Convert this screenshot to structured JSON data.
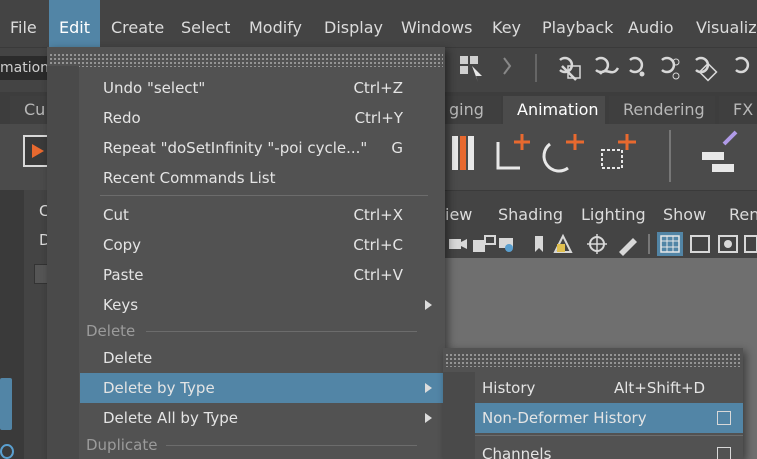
{
  "menubar": {
    "items": [
      {
        "label": "File",
        "active": false
      },
      {
        "label": "Edit",
        "active": true
      },
      {
        "label": "Create",
        "active": false
      },
      {
        "label": "Select",
        "active": false
      },
      {
        "label": "Modify",
        "active": false
      },
      {
        "label": "Display",
        "active": false
      },
      {
        "label": "Windows",
        "active": false
      },
      {
        "label": "Key",
        "active": false
      },
      {
        "label": "Playback",
        "active": false
      },
      {
        "label": "Audio",
        "active": false
      },
      {
        "label": "Visualize",
        "active": false
      }
    ]
  },
  "toolbar": {
    "mode_field": "mation"
  },
  "shelf": {
    "tabs": [
      {
        "label": "Cu",
        "active": false
      },
      {
        "label": "ging",
        "active": false
      },
      {
        "label": "Animation",
        "active": true
      },
      {
        "label": "Rendering",
        "active": false
      },
      {
        "label": "FX",
        "active": false
      }
    ]
  },
  "left_panel": {
    "labels": [
      "C",
      "D"
    ]
  },
  "viewport_panel": {
    "menu": [
      "iew",
      "Shading",
      "Lighting",
      "Show",
      "Ren"
    ]
  },
  "edit_menu": {
    "items": [
      {
        "type": "item",
        "label": "Undo \"select\"",
        "shortcut": "Ctrl+Z"
      },
      {
        "type": "item",
        "label": "Redo",
        "shortcut": "Ctrl+Y"
      },
      {
        "type": "item",
        "label": "Repeat \"doSetInfinity \"-poi cycle...\"",
        "shortcut": "G"
      },
      {
        "type": "item",
        "label": "Recent Commands List",
        "shortcut": ""
      },
      {
        "type": "separator"
      },
      {
        "type": "item",
        "label": "Cut",
        "shortcut": "Ctrl+X"
      },
      {
        "type": "item",
        "label": "Copy",
        "shortcut": "Ctrl+C"
      },
      {
        "type": "item",
        "label": "Paste",
        "shortcut": "Ctrl+V"
      },
      {
        "type": "submenu",
        "label": "Keys",
        "shortcut": ""
      },
      {
        "type": "section",
        "label": "Delete"
      },
      {
        "type": "item",
        "label": "Delete",
        "shortcut": ""
      },
      {
        "type": "submenu",
        "label": "Delete by Type",
        "shortcut": "",
        "highlighted": true
      },
      {
        "type": "submenu",
        "label": "Delete All by Type",
        "shortcut": ""
      },
      {
        "type": "section",
        "label": "Duplicate"
      }
    ]
  },
  "delete_by_type_menu": {
    "items": [
      {
        "label": "History",
        "shortcut": "Alt+Shift+D",
        "option_box": false
      },
      {
        "label": "Non-Deformer History",
        "shortcut": "",
        "option_box": true,
        "highlighted": true
      },
      {
        "label": "Channels",
        "shortcut": "",
        "option_box": true
      }
    ]
  },
  "colors": {
    "highlight": "#5285a6",
    "menu_bg": "#525252",
    "app_bg": "#444444",
    "viewport_bg": "#6f6f6f",
    "accent_orange": "#e8692f"
  }
}
